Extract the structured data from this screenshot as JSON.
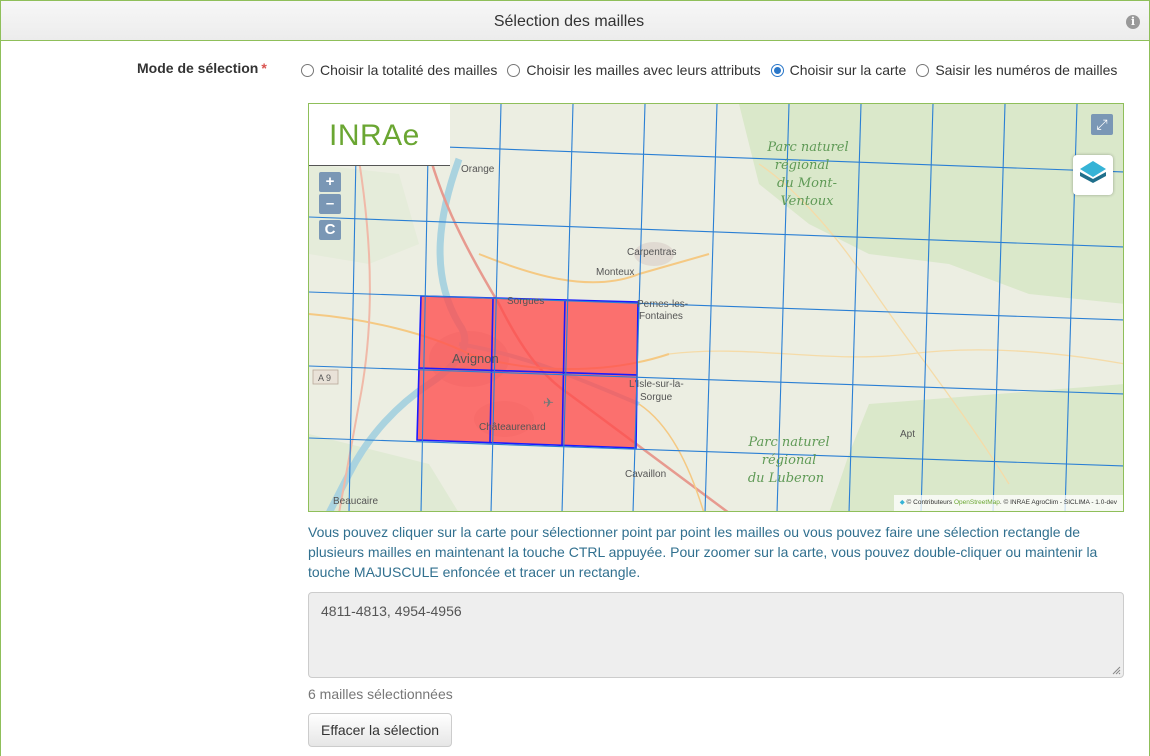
{
  "panel": {
    "title": "Sélection des mailles",
    "info_icon": "info-icon"
  },
  "form": {
    "mode_label": "Mode de sélection",
    "required_marker": "*",
    "options": [
      {
        "label": "Choisir la totalité des mailles",
        "checked": false
      },
      {
        "label": "Choisir les mailles avec leurs attributs",
        "checked": false
      },
      {
        "label": "Choisir sur la carte",
        "checked": true
      },
      {
        "label": "Saisir les numéros de mailles",
        "checked": false
      }
    ]
  },
  "map": {
    "logo": "INRAe",
    "zoom_in": "+",
    "zoom_out": "–",
    "center": "C",
    "fullscreen_icon": "expand-icon",
    "layers_icon": "layers-icon",
    "places": {
      "orange": "Orange",
      "carpentras": "Carpentras",
      "monteux": "Monteux",
      "sorgues": "Sorgues",
      "pernes_1": "Pernes-les-",
      "pernes_2": "Fontaines",
      "avignon": "Avignon",
      "isle_1": "L'Isle-sur-la-",
      "isle_2": "Sorgue",
      "chateaurenard": "Châteaurenard",
      "cavaillon": "Cavaillon",
      "beaucaire": "Beaucaire",
      "apt": "Apt",
      "a9": "A 9",
      "parc_ventoux_1": "Parc naturel",
      "parc_ventoux_2": "régional",
      "parc_ventoux_3": "du Mont-",
      "parc_ventoux_4": "Ventoux",
      "parc_luberon_1": "Parc naturel",
      "parc_luberon_2": "régional",
      "parc_luberon_3": "du Luberon"
    },
    "attribution_prefix": "© Contributeurs ",
    "attribution_osm": "OpenStreetMap",
    "attribution_suffix": ". © INRAE AgroClim - SICLIMA - 1.0-dev",
    "selected_cells_count": 6,
    "colors": {
      "grid": "#2a7fd4",
      "selection_fill": "#ff4d4d",
      "selection_stroke": "#1a1aff"
    }
  },
  "help_text": "Vous pouvez cliquer sur la carte pour sélectionner point par point les mailles ou vous pouvez faire une sélection rectangle de plusieurs mailles en maintenant la touche CTRL appuyée. Pour zoomer sur la carte, vous pouvez double-cliquer ou maintenir la touche MAJUSCULE enfoncée et tracer un rectangle.",
  "selection_value": "4811-4813, 4954-4956",
  "count_text": "6 mailles sélectionnées",
  "clear_button": "Effacer la sélection"
}
